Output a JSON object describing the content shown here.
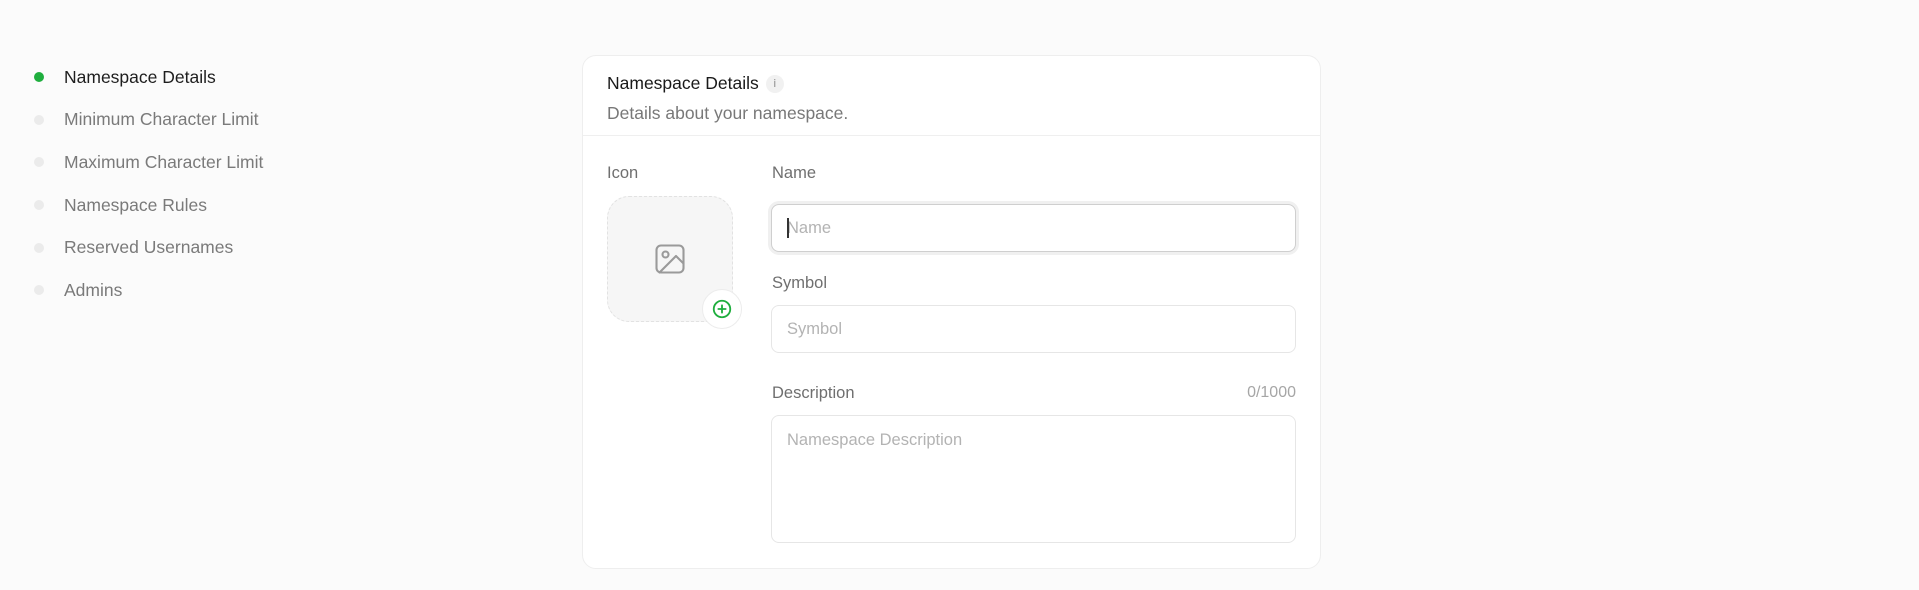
{
  "sidebar": {
    "steps": [
      {
        "label": "Namespace Details",
        "active": true
      },
      {
        "label": "Minimum Character Limit",
        "active": false
      },
      {
        "label": "Maximum Character Limit",
        "active": false
      },
      {
        "label": "Namespace Rules",
        "active": false
      },
      {
        "label": "Reserved Usernames",
        "active": false
      },
      {
        "label": "Admins",
        "active": false
      }
    ]
  },
  "card": {
    "title": "Namespace Details",
    "info_icon": "i",
    "subtitle": "Details about your namespace.",
    "icon_label": "Icon",
    "name": {
      "label": "Name",
      "placeholder": "Name",
      "value": ""
    },
    "symbol": {
      "label": "Symbol",
      "placeholder": "Symbol",
      "value": ""
    },
    "description": {
      "label": "Description",
      "placeholder": "Namespace Description",
      "value": "",
      "counter": "0/1000"
    }
  },
  "colors": {
    "accent": "#1fae3e",
    "inactive_dot": "#ebebeb"
  },
  "icons": {
    "image": "image-placeholder-icon",
    "add": "plus-circle-icon",
    "info": "info-icon"
  }
}
